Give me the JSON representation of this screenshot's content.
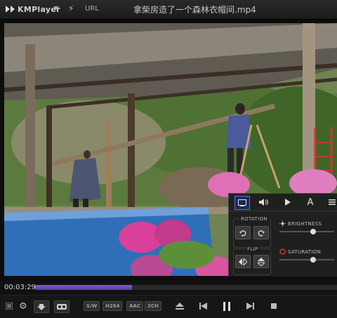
{
  "titlebar": {
    "logo_text": "KMPlayer",
    "url_label": "URL",
    "file_title": "拿柴房造了一个森林衣帽间.mp4"
  },
  "seek": {
    "current_time": "00:03:29",
    "progress_fraction": 0.32
  },
  "panel": {
    "rotation_label": "ROTATION",
    "flip_label": "FLIP",
    "brightness_label": "BRIGHTNESS",
    "saturation_label": "SATURATION",
    "brightness_level": 0.62,
    "saturation_level": 0.62,
    "text_tab_glyph": "A"
  },
  "badges": [
    "S/W",
    "H264",
    "AAC",
    "2CH"
  ],
  "colors": {
    "accent": "#5c6fd6",
    "progress": "#6a4ec0"
  }
}
